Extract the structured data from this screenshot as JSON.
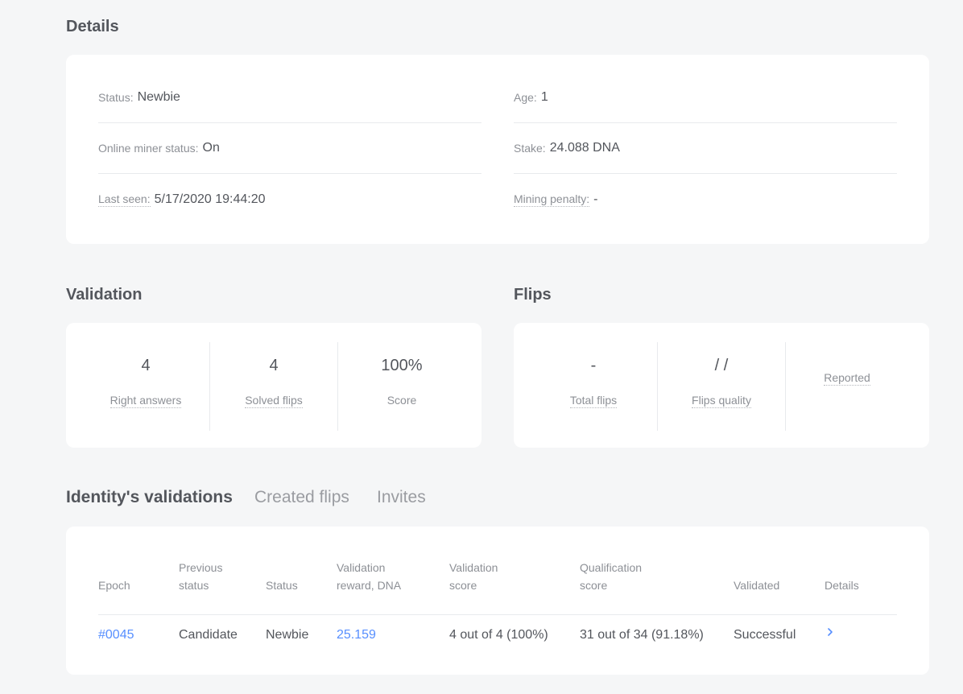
{
  "details": {
    "title": "Details",
    "status_label": "Status:",
    "status_value": "Newbie",
    "age_label": "Age:",
    "age_value": "1",
    "miner_label": "Online miner status:",
    "miner_value": "On",
    "stake_label": "Stake:",
    "stake_value": "24.088 DNA",
    "last_seen_label": "Last seen:",
    "last_seen_value": "5/17/2020 19:44:20",
    "penalty_label": "Mining penalty:",
    "penalty_value": "-"
  },
  "validation": {
    "title": "Validation",
    "right_answers_value": "4",
    "right_answers_label": "Right answers",
    "solved_flips_value": "4",
    "solved_flips_label": "Solved flips",
    "score_value": "100%",
    "score_label": "Score"
  },
  "flips": {
    "title": "Flips",
    "total_value": "-",
    "total_label": "Total flips",
    "quality_value": "/ /",
    "quality_label": "Flips quality",
    "reported_label": "Reported"
  },
  "tabs": {
    "validations": "Identity's validations",
    "created_flips": "Created flips",
    "invites": "Invites"
  },
  "table": {
    "headers": {
      "epoch": "Epoch",
      "prev_status_1": "Previous",
      "prev_status_2": "status",
      "status": "Status",
      "reward_1": "Validation",
      "reward_2": "reward, DNA",
      "vscore_1": "Validation",
      "vscore_2": "score",
      "qscore_1": "Qualification",
      "qscore_2": "score",
      "validated": "Validated",
      "details": "Details"
    },
    "rows": [
      {
        "epoch": "#0045",
        "prev_status": "Candidate",
        "status": "Newbie",
        "reward": "25.159",
        "vscore": "4 out of 4 (100%)",
        "qscore": "31 out of 34 (91.18%)",
        "validated": "Successful",
        "details_icon": "chevron-right-icon"
      }
    ]
  },
  "colors": {
    "accent": "#578fff",
    "background": "#f5f6f7",
    "card": "#ffffff"
  }
}
